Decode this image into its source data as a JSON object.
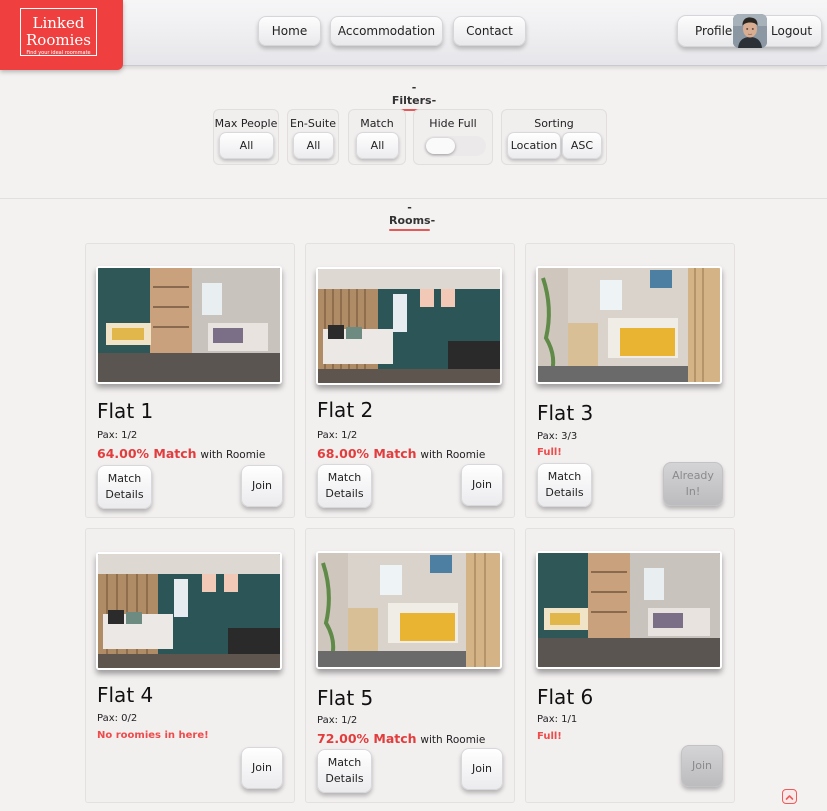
{
  "logo": {
    "line1": "Linked",
    "line2": "Roomies",
    "tagline": "Find your ideal roommate"
  },
  "nav": {
    "home": "Home",
    "accommodation": "Accommodation",
    "contact": "Contact",
    "profile": "Profile",
    "logout": "Logout"
  },
  "filters": {
    "title": "-Filters-",
    "max_people": {
      "label": "Max People",
      "value": "All"
    },
    "en_suite": {
      "label": "En-Suite",
      "value": "All"
    },
    "match": {
      "label": "Match",
      "value": "All"
    },
    "hide_full": {
      "label": "Hide Full",
      "on": false
    },
    "sorting": {
      "label": "Sorting",
      "by": "Location",
      "order": "ASC"
    }
  },
  "rooms": {
    "title": "-Rooms-",
    "items": [
      {
        "name": "Flat 1",
        "pax": "Pax: 1/2",
        "match_pct": "64.00% Match",
        "match_suffix": "with Roomie",
        "details_line1": "Match",
        "details_line2": "Details",
        "join": "Join"
      },
      {
        "name": "Flat 2",
        "pax": "Pax: 1/2",
        "match_pct": "68.00% Match",
        "match_suffix": "with Roomie",
        "details_line1": "Match",
        "details_line2": "Details",
        "join": "Join"
      },
      {
        "name": "Flat 3",
        "pax": "Pax: 3/3",
        "status": "Full!",
        "details_line1": "Match",
        "details_line2": "Details",
        "join_line1": "Already",
        "join_line2": "In!"
      },
      {
        "name": "Flat 4",
        "pax": "Pax: 0/2",
        "status": "No roomies in here!",
        "join": "Join"
      },
      {
        "name": "Flat 5",
        "pax": "Pax: 1/2",
        "match_pct": "72.00% Match",
        "match_suffix": "with Roomie",
        "details_line1": "Match",
        "details_line2": "Details",
        "join": "Join"
      },
      {
        "name": "Flat 6",
        "pax": "Pax: 1/1",
        "status": "Full!",
        "join": "Join"
      }
    ]
  },
  "icons": {
    "scroll_top": "chevron-up-icon"
  },
  "colors": {
    "brand": "#ef3f3f",
    "accent_text": "#e23c3c",
    "background": "#f4f1f1"
  }
}
